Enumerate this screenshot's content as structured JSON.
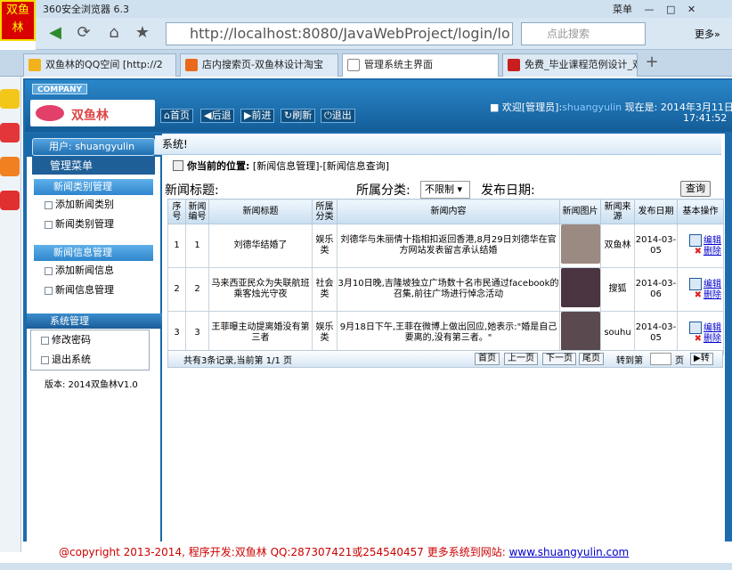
{
  "browser": {
    "logo_line1": "双鱼",
    "logo_line2": "林",
    "title": "360安全浏览器 6.3",
    "menu": "菜单",
    "address": "http://localhost:8080/JavaWebProject/login/lo",
    "address_host": "localhost",
    "search_placeholder": "点此搜索",
    "more": "更多»",
    "tabs": [
      {
        "label": "双鱼林的QQ空间 [http://2"
      },
      {
        "label": "店内搜索页-双鱼林设计淘宝"
      },
      {
        "label": "管理系统主界面"
      },
      {
        "label": "免费_毕业课程范例设计_双"
      }
    ]
  },
  "header": {
    "company": "COMPANY",
    "brand": "双鱼林",
    "buttons": [
      "首页",
      "后退",
      "前进",
      "刷新",
      "退出"
    ],
    "welcome_prefix": "欢迎[管理员]:",
    "welcome_user": "shuangyulin",
    "welcome_suffix": "现在是: 2014年3月11日",
    "time": "17:41:52"
  },
  "sidebar": {
    "user": "用户: shuangyulin",
    "menu_title": "管理菜单",
    "groups": [
      {
        "title": "新闻类别管理",
        "items": [
          "添加新闻类别",
          "新闻类别管理"
        ]
      },
      {
        "title": "新闻信息管理",
        "items": [
          "添加新闻信息",
          "新闻信息管理"
        ]
      }
    ],
    "sys_title": "系统管理",
    "sys_items": [
      "修改密码",
      "退出系统"
    ],
    "version": "版本: 2014双鱼林V1.0"
  },
  "main": {
    "title": "系统!",
    "position_label": "你当前的位置:",
    "position_path": "[新闻信息管理]-[新闻信息查询]",
    "filter_title_label": "新闻标题:",
    "filter_category_label": "所属分类:",
    "filter_category_value": "不限制",
    "filter_date_label": "发布日期:",
    "query_button": "查询",
    "columns": [
      "序号",
      "新闻编号",
      "新闻标题",
      "所属分类",
      "新闻内容",
      "新闻图片",
      "新闻来源",
      "发布日期",
      "基本操作"
    ],
    "rows": [
      {
        "seq": "1",
        "id": "1",
        "title": "刘德华结婚了",
        "category": "娱乐类",
        "content": "刘德华与朱丽倩十指相扣返回香港,8月29日刘德华在官方网站发表留言承认结婚",
        "source": "双鱼林",
        "date": "2014-03-05",
        "img_color": "#9a8a82"
      },
      {
        "seq": "2",
        "id": "2",
        "title": "马来西亚民众为失联航班乘客烛光守夜",
        "category": "社会类",
        "content": "3月10日晚,吉隆坡独立广场数十名市民通过facebook的召集,前往广场进行悼念活动",
        "source": "搜狐",
        "date": "2014-03-06",
        "img_color": "#4a3440"
      },
      {
        "seq": "3",
        "id": "3",
        "title": "王菲曝主动提离婚没有第三者",
        "category": "娱乐类",
        "content": "9月18日下午,王菲在微博上做出回应,她表示:\"婚是自己要离的,没有第三者。\"",
        "source": "souhu",
        "date": "2014-03-05",
        "img_color": "#5a4a50"
      }
    ],
    "edit_label": "编辑",
    "delete_label": "删除",
    "pager_text": "共有3条记录,当前第 1/1 页",
    "pager_buttons": [
      "首页",
      "上一页",
      "下一页",
      "尾页"
    ],
    "goto_label": "转到第",
    "page_label": "页",
    "goto_button": "转"
  },
  "footer": {
    "text": "@copyright 2013-2014, 程序开发:双鱼林 QQ:287307421或254540457 更多系统到网站:",
    "url": "www.shuangyulin.com"
  },
  "colors": {
    "frame": "#1d6cae",
    "header": "#2a86c8",
    "link": "#0000cc",
    "footer": "#cc0000"
  }
}
